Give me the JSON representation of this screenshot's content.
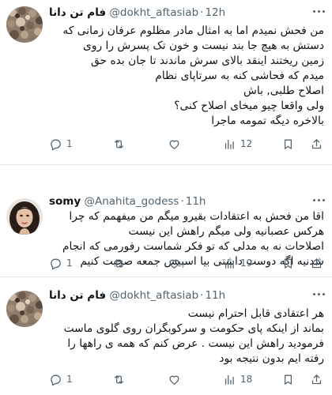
{
  "tweets": [
    {
      "display_name": "فام تن دانا",
      "handle": "@dokht_aftasiab",
      "separator": "·",
      "time": "12h",
      "lines": [
        "من فحش نمیدم اما به امثال مادر مظلوم عرفان زمانی که",
        "دستش به هیچ جا بند نیست و خون تک پسرش را روی",
        "زمین ریختند اینقد بالای سرش ماندند تا جان بده حق",
        "میدم که فحاشی کنه به سرتاپای نظام",
        "اصلاح طلبی, باش",
        "ولی واقعا چیو میخای اصلاح کنی؟",
        "بالاخره دیگه تمومه ماجرا"
      ],
      "stats": {
        "replies": "1",
        "retweets": "",
        "likes": "",
        "views": "12"
      }
    },
    {
      "display_name": "somy",
      "handle": "@Anahita_godess",
      "separator": "·",
      "time": "11h",
      "lines": [
        "اقا من فحش به اعتقادات بقیرو میگم من میفهمم که چرا",
        "هرکس عصبانیه ولی میگم راهش این نیست",
        "اصلاحات نه به مدلی که تو فکر شماست رفورمی که انجام",
        "شدنیه اگه دوست داشتی بیا اسپیس جمعه صحبت کنیم"
      ],
      "stats": {
        "replies": "1",
        "retweets": "",
        "likes": "",
        "views": "19"
      }
    },
    {
      "display_name": "فام تن دانا",
      "handle": "@dokht_aftasiab",
      "separator": "·",
      "time": "11h",
      "lines": [
        "هر اعتقادی قابل احترام نیست",
        "بماند از اینکه پای حکومت و سرکوبگران روی گلوی ماست",
        "فرمودید راهش این نیست . عرض کنم که همه ی راهها را",
        "رفته ایم بدون نتیجه بود"
      ],
      "stats": {
        "replies": "1",
        "retweets": "",
        "likes": "",
        "views": "18"
      }
    }
  ],
  "colors": {
    "text": "#0f1419",
    "muted": "#536471",
    "divider": "#e4e8ec"
  },
  "icons": {
    "reply": "reply-icon",
    "retweet": "retweet-icon",
    "like": "like-icon",
    "views": "views-icon",
    "bookmark": "bookmark-icon",
    "share": "share-icon",
    "more": "more-icon"
  }
}
